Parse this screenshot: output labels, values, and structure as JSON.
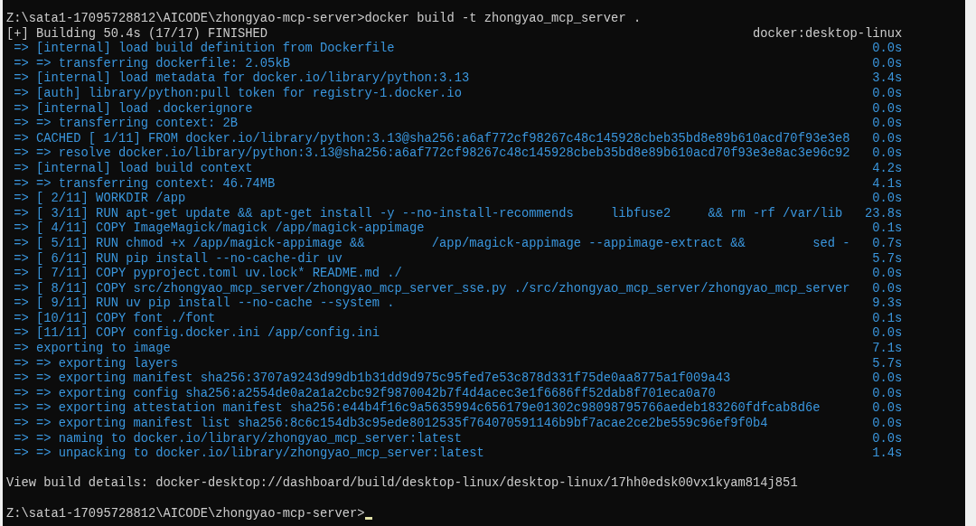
{
  "terminal": {
    "command_line": "Z:\\sata1-17095728812\\AICODE\\zhongyao-mcp-server>docker build -t zhongyao_mcp_server .",
    "build_status": {
      "text": "[+] Building 50.4s (17/17) FINISHED",
      "builder": "docker:desktop-linux"
    },
    "steps": [
      {
        "text": "=> [internal] load build definition from Dockerfile",
        "duration": "0.0s"
      },
      {
        "text": "=> => transferring dockerfile: 2.05kB",
        "duration": "0.0s"
      },
      {
        "text": "=> [internal] load metadata for docker.io/library/python:3.13",
        "duration": "3.4s"
      },
      {
        "text": "=> [auth] library/python:pull token for registry-1.docker.io",
        "duration": "0.0s"
      },
      {
        "text": "=> [internal] load .dockerignore",
        "duration": "0.0s"
      },
      {
        "text": "=> => transferring context: 2B",
        "duration": "0.0s"
      },
      {
        "text": "=> CACHED [ 1/11] FROM docker.io/library/python:3.13@sha256:a6af772cf98267c48c145928cbeb35bd8e89b610acd70f93e3e8",
        "duration": "0.0s"
      },
      {
        "text": "=> => resolve docker.io/library/python:3.13@sha256:a6af772cf98267c48c145928cbeb35bd8e89b610acd70f93e3e8ac3e96c92",
        "duration": "0.0s"
      },
      {
        "text": "=> [internal] load build context",
        "duration": "4.2s"
      },
      {
        "text": "=> => transferring context: 46.74MB",
        "duration": "4.1s"
      },
      {
        "text": "=> [ 2/11] WORKDIR /app",
        "duration": "0.0s"
      },
      {
        "text": "=> [ 3/11] RUN apt-get update && apt-get install -y --no-install-recommends     libfuse2     && rm -rf /var/lib",
        "duration": "23.8s"
      },
      {
        "text": "=> [ 4/11] COPY ImageMagick/magick /app/magick-appimage",
        "duration": "0.1s"
      },
      {
        "text": "=> [ 5/11] RUN chmod +x /app/magick-appimage &&         /app/magick-appimage --appimage-extract &&         sed -",
        "duration": "0.7s"
      },
      {
        "text": "=> [ 6/11] RUN pip install --no-cache-dir uv",
        "duration": "5.7s"
      },
      {
        "text": "=> [ 7/11] COPY pyproject.toml uv.lock* README.md ./",
        "duration": "0.0s"
      },
      {
        "text": "=> [ 8/11] COPY src/zhongyao_mcp_server/zhongyao_mcp_server_sse.py ./src/zhongyao_mcp_server/zhongyao_mcp_server",
        "duration": "0.0s"
      },
      {
        "text": "=> [ 9/11] RUN uv pip install --no-cache --system .",
        "duration": "9.3s"
      },
      {
        "text": "=> [10/11] COPY font ./font",
        "duration": "0.1s"
      },
      {
        "text": "=> [11/11] COPY config.docker.ini /app/config.ini",
        "duration": "0.0s"
      },
      {
        "text": "=> exporting to image",
        "duration": "7.1s"
      },
      {
        "text": "=> => exporting layers",
        "duration": "5.7s"
      },
      {
        "text": "=> => exporting manifest sha256:3707a9243d99db1b31dd9d975c95fed7e53c878d331f75de0aa8775a1f009a43",
        "duration": "0.0s"
      },
      {
        "text": "=> => exporting config sha256:a2554de0a2a1a2cbc92f9870042b7f4d4acec3e1f6686ff52dab8f701eca0a70",
        "duration": "0.0s"
      },
      {
        "text": "=> => exporting attestation manifest sha256:e44b4f16c9a5635994c656179e01302c98098795766aedeb183260fdfcab8d6e",
        "duration": "0.0s"
      },
      {
        "text": "=> => exporting manifest list sha256:8c6c154db3c95ede8012535f764070591146b9bf7acae2ce2be559c96ef9f0b4",
        "duration": "0.0s"
      },
      {
        "text": "=> => naming to docker.io/library/zhongyao_mcp_server:latest",
        "duration": "0.0s"
      },
      {
        "text": "=> => unpacking to docker.io/library/zhongyao_mcp_server:latest",
        "duration": "1.4s"
      }
    ],
    "build_details": "View build details: docker-desktop://dashboard/build/desktop-linux/desktop-linux/17hh0edsk00vx1kyam814j851",
    "prompt": "Z:\\sata1-17095728812\\AICODE\\zhongyao-mcp-server>"
  }
}
